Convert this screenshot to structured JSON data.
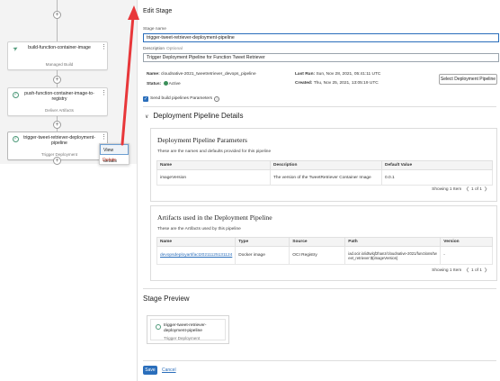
{
  "canvas": {
    "stages": [
      {
        "name": "build-function-container-image",
        "type": "Managed Build",
        "icon": "build-icon"
      },
      {
        "name": "push-function-container-image-to-registry",
        "type": "Deliver Artifacts",
        "icon": "deliver-icon"
      },
      {
        "name": "trigger-tweet-retriever-deployment-pipeline",
        "type": "Trigger Deployment",
        "icon": "trigger-icon"
      }
    ],
    "add_symbol": "+",
    "context_menu": {
      "view_details": "View details",
      "delete": "Delete"
    }
  },
  "panel": {
    "title": "Edit Stage",
    "stage_name_label": "Stage name",
    "stage_name_value": "trigger-tweet-retriever-deployment-pipeline",
    "description_label": "Description",
    "description_optional": "Optional",
    "description_value": "Trigger Deployment Pipeline for Function Tweet Retriever",
    "info": {
      "name_key": "Name:",
      "name_value": "cloudnative-2021_tweetretriever_devops_pipeline",
      "status_key": "Status:",
      "status_value": "Active",
      "last_run_key": "Last Run:",
      "last_run_value": "Sun, Nov 28, 2021, 05:41:11 UTC",
      "created_key": "Created:",
      "created_value": "Thu, Nov 25, 2021, 13:05:19 UTC"
    },
    "select_button": "Select Deployment Pipeline",
    "send_params_label": "Send build pipelines Parameters",
    "details_header": "Deployment Pipeline Details",
    "params": {
      "title": "Deployment Pipeline Parameters",
      "desc": "These are the names and defaults provided for this pipeline",
      "columns": [
        "Name",
        "Description",
        "Default Value"
      ],
      "rows": [
        {
          "name": "imageVersion",
          "description": "The version of the TweetRetriever Container Image",
          "default": "0.0.1"
        }
      ],
      "showing": "Showing 1 Item",
      "page": "1 of 1"
    },
    "artifacts": {
      "title": "Artifacts used in the Deployment Pipeline",
      "desc": "These are the Artifacts used by this pipeline",
      "columns": [
        "Name",
        "Type",
        "Source",
        "Path",
        "Version"
      ],
      "rows": [
        {
          "name": "devopsdeployartifact20211125131124",
          "type": "Docker image",
          "source": "OCI Registry",
          "path": "iad.ocir.io/idtwlqf2hanz/cloudnative-2021/functions/tweet_retriever:${imageVersion}",
          "version": "-"
        }
      ],
      "showing": "Showing 1 Item",
      "page": "1 of 1"
    },
    "preview_title": "Stage Preview",
    "preview": {
      "name": "trigger-tweet-retriever-deployment-pipeline",
      "type": "Trigger Deployment"
    },
    "save": "Save",
    "cancel": "Cancel"
  },
  "colors": {
    "accent": "#2a6ebb",
    "annotation": "#e8373a",
    "status_active": "#3c8f5a",
    "danger": "#c74634"
  }
}
